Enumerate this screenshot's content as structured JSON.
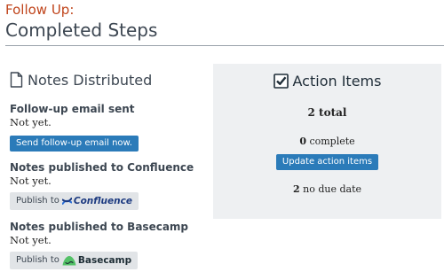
{
  "header": {
    "kicker": "Follow Up:",
    "title": "Completed Steps"
  },
  "notes": {
    "title": "Notes Distributed",
    "icon": "document-icon",
    "items": [
      {
        "title": "Follow-up email sent",
        "status": "Not yet.",
        "button": "Send follow-up email now."
      },
      {
        "title": "Notes published to Confluence",
        "status": "Not yet.",
        "button_prefix": "Publish to",
        "logo_text": "Confluence"
      },
      {
        "title": "Notes published to Basecamp",
        "status": "Not yet.",
        "button_prefix": "Publish to",
        "logo_text": "Basecamp"
      }
    ]
  },
  "action_items": {
    "title": "Action Items",
    "icon": "checkbox-checked-icon",
    "total_count": "2",
    "total_label": "total",
    "complete_count": "0",
    "complete_label": "complete",
    "update_button": "Update action items",
    "no_due_count": "2",
    "no_due_label": "no due date"
  },
  "colors": {
    "accent_orange": "#c0451c",
    "primary_blue": "#2b7bb9",
    "heading": "#3d4752",
    "panel_bg": "#eef0f2",
    "gray_button": "#e1e4e7"
  }
}
